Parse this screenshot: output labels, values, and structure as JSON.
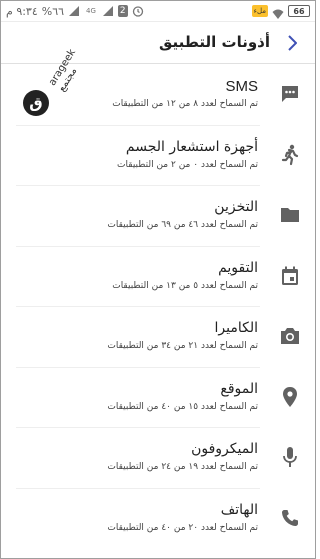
{
  "status_bar": {
    "time": "٩:٣٤ م",
    "battery_label": "ملء",
    "battery_percent": "66",
    "network": "4G",
    "sim_badge": "2",
    "signal_text": "%٦٦"
  },
  "header": {
    "title": "أذونات التطبيق",
    "back_icon": "chevron-right-icon"
  },
  "watermark": {
    "text_arabic": "مجتمع",
    "text_latin": "arageek"
  },
  "permissions": [
    {
      "title": "SMS",
      "subtitle": "تم السماح لعدد ٨ من ١٢ من التطبيقات",
      "icon": "sms-icon"
    },
    {
      "title": "أجهزة استشعار الجسم",
      "subtitle": "تم السماح لعدد ٠ من ٢ من التطبيقات",
      "icon": "body-sensors-icon"
    },
    {
      "title": "التخزين",
      "subtitle": "تم السماح لعدد ٤٦ من ٦٩ من التطبيقات",
      "icon": "folder-icon"
    },
    {
      "title": "التقويم",
      "subtitle": "تم السماح لعدد ٥ من ١٣ من التطبيقات",
      "icon": "calendar-icon"
    },
    {
      "title": "الكاميرا",
      "subtitle": "تم السماح لعدد ٢١ من ٣٤ من التطبيقات",
      "icon": "camera-icon"
    },
    {
      "title": "الموقع",
      "subtitle": "تم السماح لعدد ١٥ من ٤٠ من التطبيقات",
      "icon": "location-icon"
    },
    {
      "title": "الميكروفون",
      "subtitle": "تم السماح لعدد ١٩ من ٢٤ من التطبيقات",
      "icon": "microphone-icon"
    },
    {
      "title": "الهاتف",
      "subtitle": "تم السماح لعدد ٢٠ من ٤٠ من التطبيقات",
      "icon": "phone-icon"
    }
  ],
  "colors": {
    "icon": "#616161",
    "back_chevron": "#3f51b5",
    "battery_badge": "#fbc02d"
  }
}
